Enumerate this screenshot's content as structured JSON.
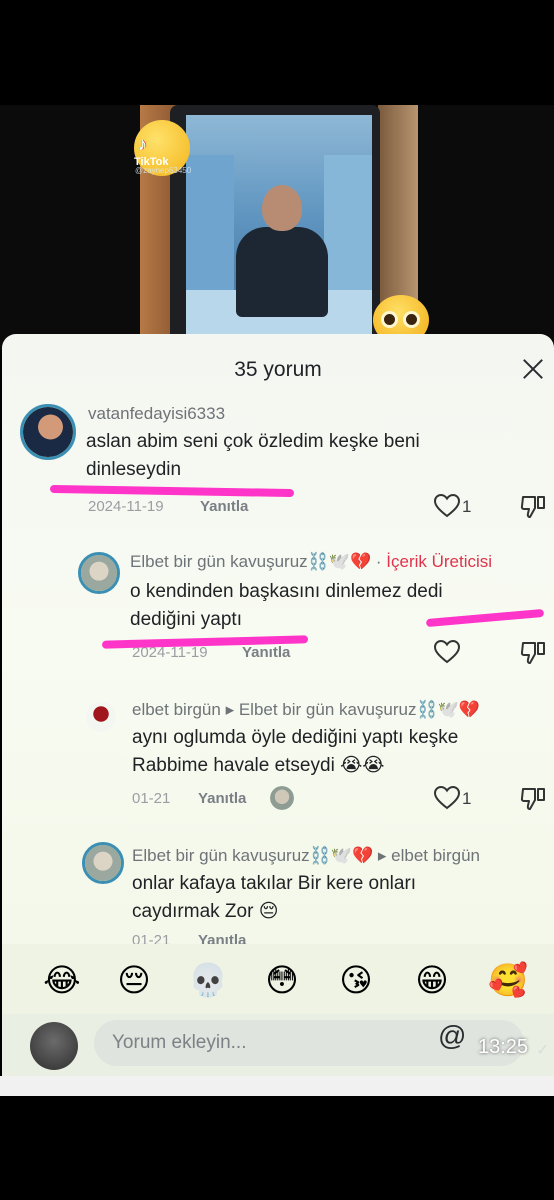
{
  "video": {
    "brand": "TikTok",
    "handle": "@zaynep63450"
  },
  "sheet": {
    "title": "35 yorum"
  },
  "comments": [
    {
      "username": "vatanfedayisi6333",
      "text_line1": "aslan abim seni çok özledim keşke beni",
      "text_line2": "dinleseydin",
      "date": "2024-11-19",
      "reply_label": "Yanıtla",
      "likes": "1"
    },
    {
      "username": "Elbet bir gün kavuşuruz⛓️🕊️💔",
      "creator_sep": " · ",
      "creator_tag": "İçerik Üreticisi",
      "text_line1": "o kendinden başkasını dinlemez dedi",
      "text_line2": "dediğini yaptı",
      "date": "2024-11-19",
      "reply_label": "Yanıtla"
    },
    {
      "username": "elbet birgün ▸ Elbet bir gün kavuşuruz⛓️🕊️💔",
      "text_line1": "aynı oglumda öyle dediğini yaptı keşke",
      "text_line2": "Rabbime havale etseydi 😭😭",
      "date": "01-21",
      "reply_label": "Yanıtla",
      "likes": "1"
    },
    {
      "username": "Elbet bir gün kavuşuruz⛓️🕊️💔 ▸ elbet birgün",
      "text_line1": "onlar kafaya takılar Bir kere onları",
      "text_line2": "caydırmak Zor 😔",
      "date": "01-21",
      "reply_label": "Yanıtla"
    }
  ],
  "emoji_bar": [
    "😂",
    "😔",
    "💀",
    "😳",
    "😘",
    "😁",
    "🥰"
  ],
  "input": {
    "placeholder": "Yorum ekleyin...",
    "at_symbol": "@"
  },
  "status": {
    "time": "13:25",
    "check": "✓"
  },
  "colors": {
    "highlight": "#ff35c9",
    "creator": "#e0344c",
    "sheet_bg": "#f4f6f1"
  }
}
